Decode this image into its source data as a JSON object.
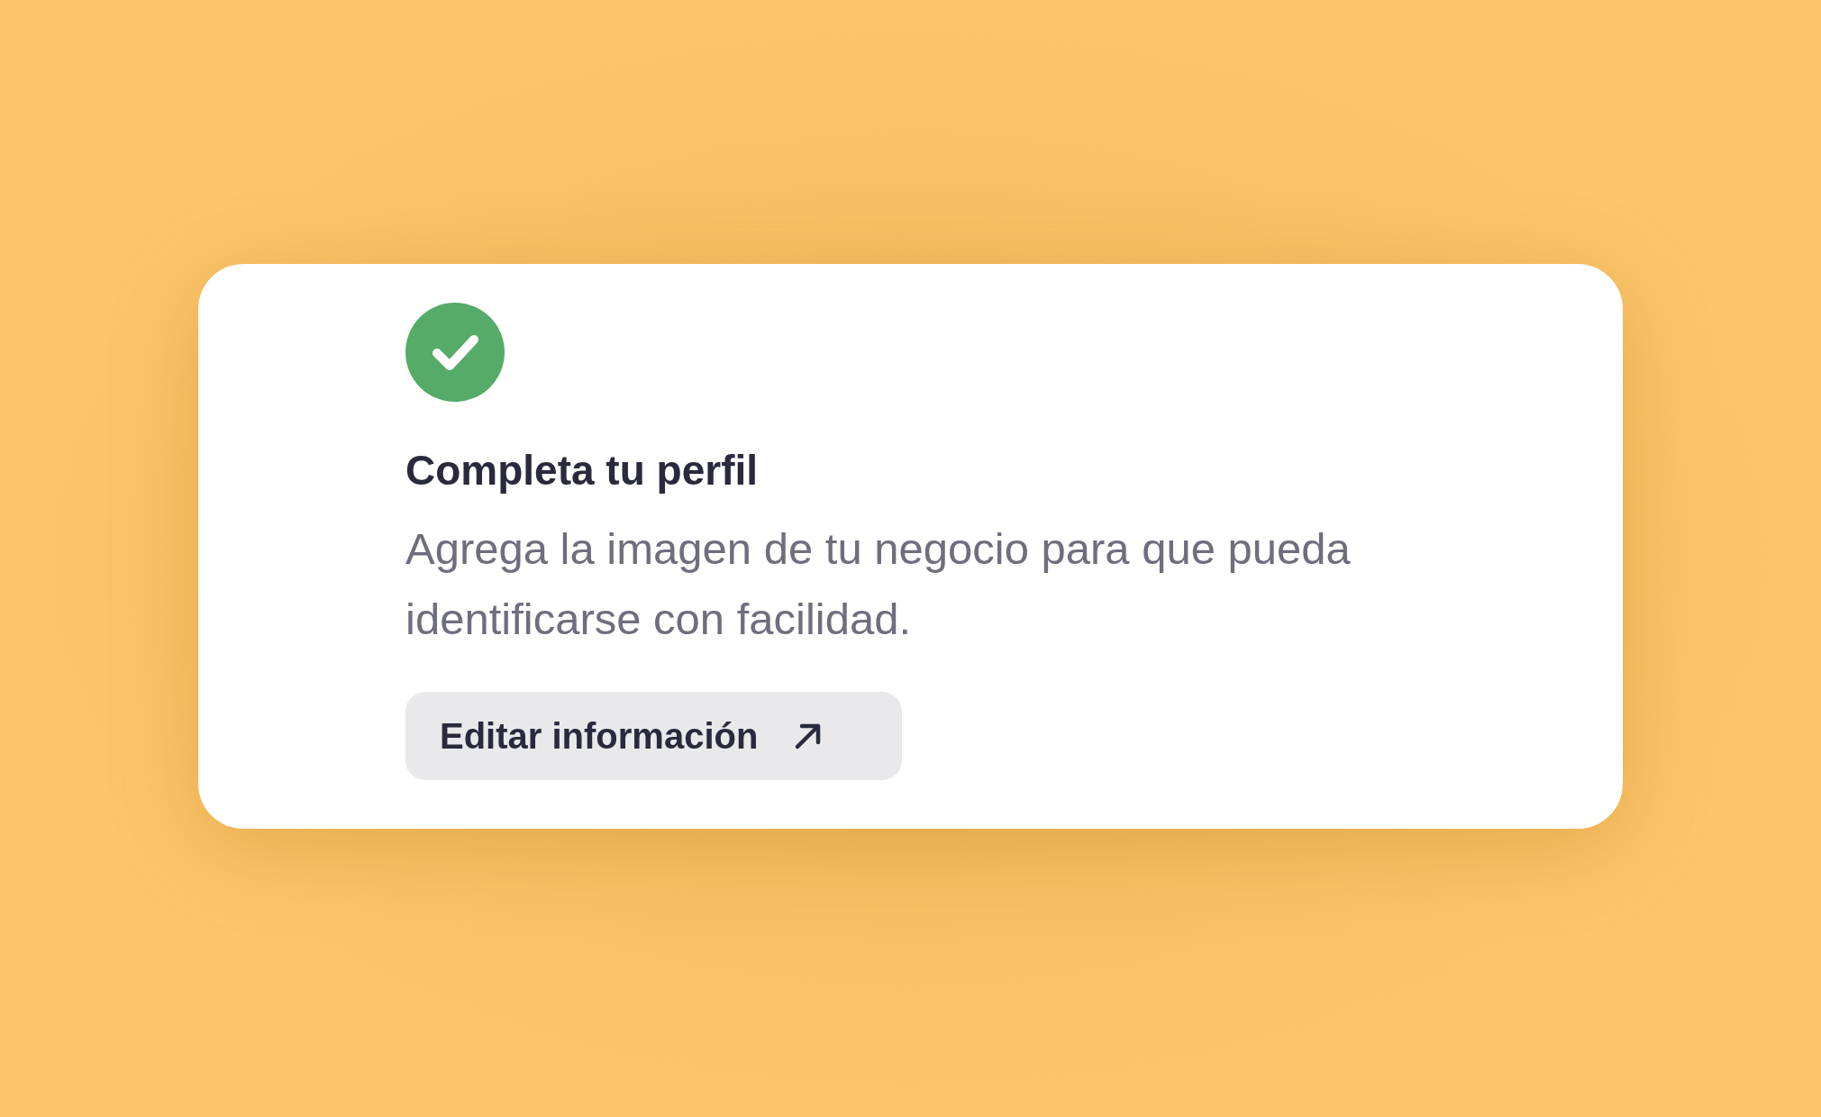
{
  "card": {
    "completed": true,
    "title": "Completa tu perfil",
    "description": "Agrega la imagen de tu negocio para que pueda identificarse con facilidad.",
    "button": {
      "label": "Editar información"
    }
  }
}
